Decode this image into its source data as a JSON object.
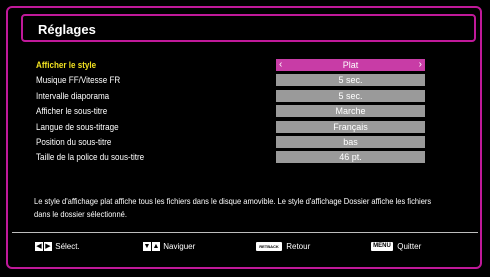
{
  "header": {
    "title": "Réglages"
  },
  "settings": [
    {
      "label": "Afficher le style",
      "value": "Plat",
      "active": true
    },
    {
      "label": "Musique FF/Vitesse FR",
      "value": "5 sec."
    },
    {
      "label": "Intervalle diaporama",
      "value": "5 sec."
    },
    {
      "label": "Afficher le sous-titre",
      "value": "Marche"
    },
    {
      "label": "Langue de sous-titrage",
      "value": "Français"
    },
    {
      "label": "Position du sous-titre",
      "value": "bas"
    },
    {
      "label": "Taille de la police du sous-titre",
      "value": "46 pt."
    }
  ],
  "help_text": "Le style d'affichage plat affiche tous les fichiers dans le disque amovible. Le style d'affichage Dossier affiche les fichiers dans le dossier sélectionné.",
  "footer": {
    "select": {
      "keys": [
        "◀",
        "▶"
      ],
      "label": "Sélect."
    },
    "navigate": {
      "keys": [
        "▼",
        "▲"
      ],
      "label": "Naviguer"
    },
    "back": {
      "key": "RETBACK",
      "label": "Retour"
    },
    "menu": {
      "key": "MENU",
      "label": "Quitter"
    }
  },
  "colors": {
    "accent": "#c0199a",
    "highlight": "#c83ca6",
    "value_bg": "#9a9a9a",
    "active_label": "#f0e020"
  }
}
